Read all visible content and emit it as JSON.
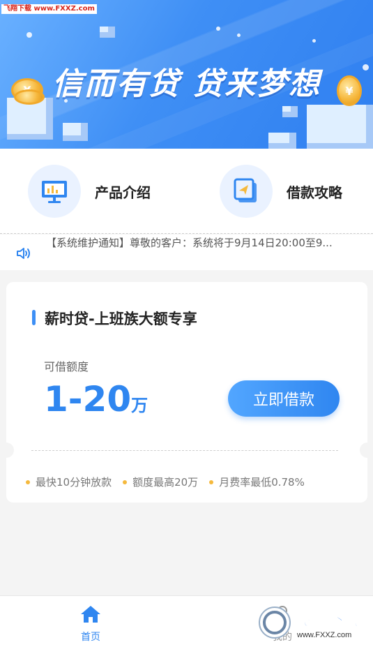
{
  "watermark": "飞翔下载 www.FXXZ.com",
  "banner": {
    "title": "信而有贷  贷来梦想",
    "coin_symbol": "¥"
  },
  "quick_entries": [
    {
      "label": "产品介绍",
      "icon": "presentation-chart-icon"
    },
    {
      "label": "借款攻略",
      "icon": "guide-arrow-icon"
    }
  ],
  "notice": {
    "icon": "speaker-icon",
    "text": "【系统维护通知】尊敬的客户：系统将于9月14日20:00至9..."
  },
  "product": {
    "title": "薪时贷-上班族大额专享",
    "quota_label": "可借额度",
    "quota_value": "1-20",
    "quota_unit": "万",
    "apply_button": "立即借款",
    "features": [
      "最快10分钟放款",
      "额度最高20万",
      "月费率最低0.78%"
    ]
  },
  "bottom_nav": {
    "items": [
      {
        "label": "首页",
        "icon": "home-icon",
        "active": true
      },
      {
        "label": "我的",
        "icon": "user-icon",
        "active": false
      }
    ]
  },
  "brand_logo": {
    "text": "飞翔下载",
    "url_text": "www.FXXZ.com"
  },
  "colors": {
    "accent": "#2f86f0",
    "bullet": "#f5b93c",
    "banner_start": "#6ab1ff",
    "banner_end": "#2f7ff0"
  }
}
